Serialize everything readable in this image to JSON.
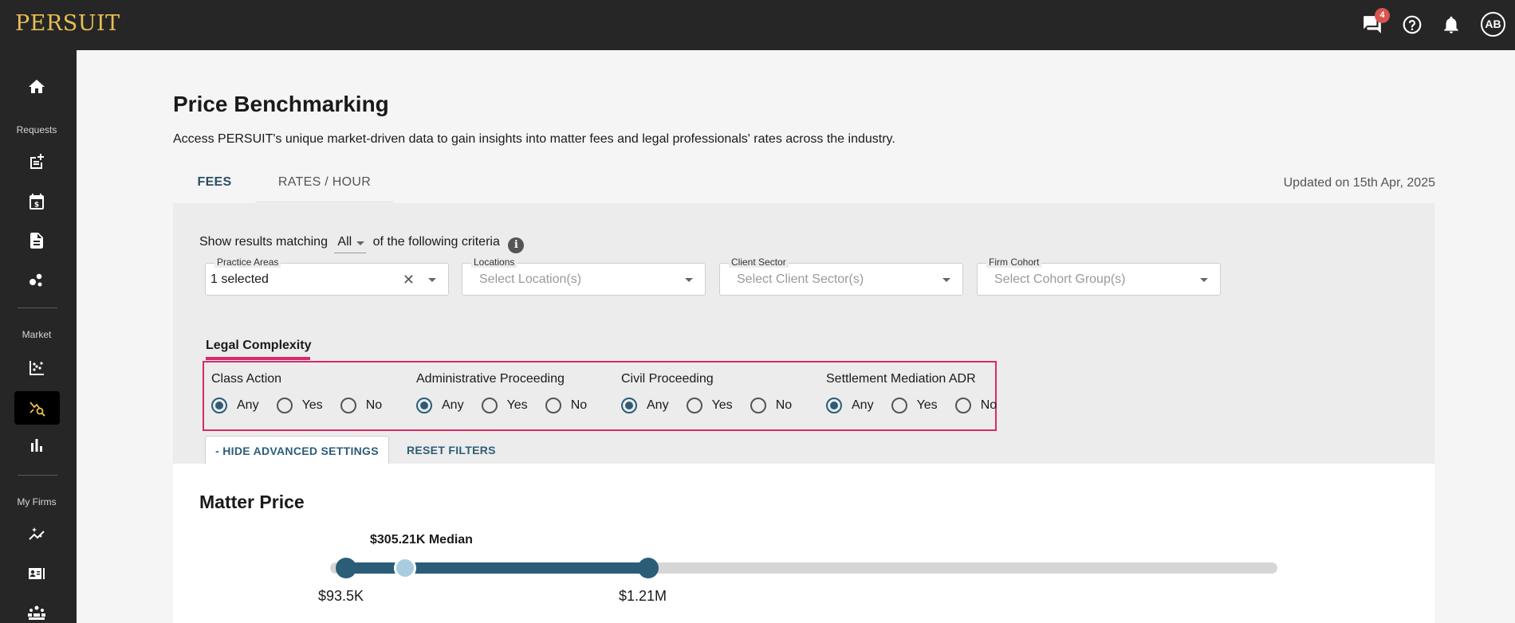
{
  "app": {
    "logo": "PERSUIT"
  },
  "topbar": {
    "messages_badge": "4",
    "avatar_initials": "AB"
  },
  "sidebar": {
    "sections": {
      "requests": "Requests",
      "market": "Market",
      "my_firms": "My Firms"
    }
  },
  "page": {
    "title": "Price Benchmarking",
    "description": "Access PERSUIT's unique market-driven data to gain insights into matter fees and legal professionals' rates across the industry.",
    "tabs": [
      {
        "label": "FEES",
        "active": true
      },
      {
        "label": "RATES / HOUR",
        "active": false
      }
    ],
    "updated": "Updated on 15th Apr, 2025"
  },
  "filters": {
    "criteria_prefix": "Show results matching",
    "criteria_select": "All",
    "criteria_suffix": "of the following criteria",
    "fields": [
      {
        "label": "Practice Areas",
        "value": "1 selected",
        "placeholder": ""
      },
      {
        "label": "Locations",
        "value": "",
        "placeholder": "Select Location(s)"
      },
      {
        "label": "Client Sector",
        "value": "",
        "placeholder": "Select Client Sector(s)"
      },
      {
        "label": "Firm Cohort",
        "value": "",
        "placeholder": "Select Cohort Group(s)"
      }
    ],
    "legal_complexity": {
      "title": "Legal Complexity",
      "options": [
        "Any",
        "Yes",
        "No"
      ],
      "groups": [
        {
          "title": "Class Action",
          "selected": "Any"
        },
        {
          "title": "Administrative Proceeding",
          "selected": "Any"
        },
        {
          "title": "Civil Proceeding",
          "selected": "Any"
        },
        {
          "title": "Settlement Mediation ADR",
          "selected": "Any"
        }
      ]
    },
    "hide_advanced": "- HIDE ADVANCED SETTINGS",
    "reset": "RESET FILTERS"
  },
  "matter_price": {
    "title": "Matter Price",
    "median_label": "$305.21K Median",
    "min_label": "$93.5K",
    "max_label": "$1.21M",
    "min_fraction": 0.017,
    "median_fraction": 0.079,
    "max_fraction": 0.336
  },
  "colors": {
    "accent": "#2c5d78",
    "highlight": "#d62a6b",
    "logo": "#e8bf52"
  }
}
